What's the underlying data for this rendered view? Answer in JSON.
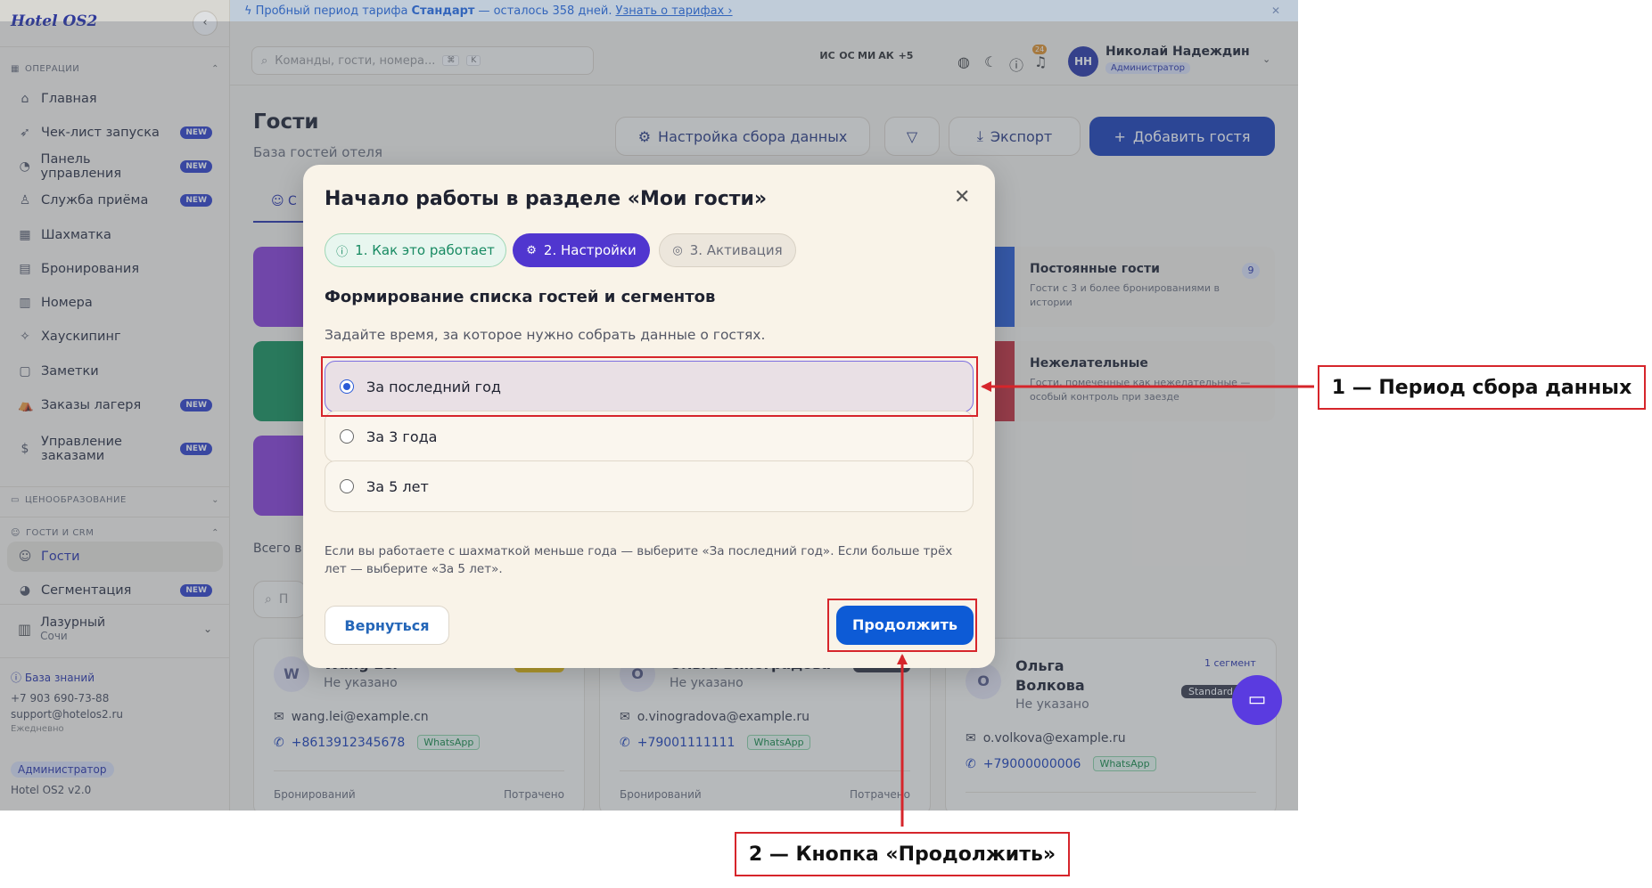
{
  "sidebar": {
    "logo": "Hotel OS2",
    "section_operations": "ОПЕРАЦИИ",
    "items": [
      {
        "label": "Главная",
        "icon": "home-icon",
        "glyph": "⌂",
        "new": false
      },
      {
        "label": "Чек-лист запуска",
        "icon": "rocket-icon",
        "glyph": "➶",
        "new": true
      },
      {
        "label": "Панель управления",
        "icon": "gauge-icon",
        "glyph": "◔",
        "new": true
      },
      {
        "label": "Служба приёма",
        "icon": "bell-icon",
        "glyph": "♙",
        "new": true
      },
      {
        "label": "Шахматка",
        "icon": "grid-icon",
        "glyph": "▦",
        "new": false
      },
      {
        "label": "Бронирования",
        "icon": "clipboard-icon",
        "glyph": "▤",
        "new": false
      },
      {
        "label": "Номера",
        "icon": "building-icon",
        "glyph": "▥",
        "new": false
      },
      {
        "label": "Хаускипинг",
        "icon": "sparkle-icon",
        "glyph": "✧",
        "new": false
      },
      {
        "label": "Заметки",
        "icon": "note-icon",
        "glyph": "▢",
        "new": false
      },
      {
        "label": "Заказы лагеря",
        "icon": "tent-icon",
        "glyph": "⛺",
        "new": true
      },
      {
        "label": "Управление заказами",
        "icon": "dollar-icon",
        "glyph": "$",
        "new": true
      }
    ],
    "section_pricing": "ЦЕНООБРАЗОВАНИЕ",
    "section_crm": "ГОСТИ И CRM",
    "crm_items": [
      {
        "label": "Гости",
        "icon": "users-icon",
        "glyph": "☺",
        "new": false,
        "active": true
      },
      {
        "label": "Сегментация",
        "icon": "pie-icon",
        "glyph": "◕",
        "new": true,
        "active": false
      }
    ],
    "new_badge": "NEW",
    "org_name": "Лазурный",
    "org_city": "Сочи",
    "kb_link": "База знаний",
    "phone": "+7 903 690-73-88",
    "email": "support@hotelos2.ru",
    "schedule": "Ежедневно",
    "role": "Администратор",
    "version": "Hotel OS2 v2.0"
  },
  "banner": {
    "text1": "Пробный период тарифа",
    "plan": "Стандарт",
    "text2": "— осталось 358 дней.",
    "link": "Узнать о тарифах ›"
  },
  "topbar": {
    "search_placeholder": "Команды, гости, номера...",
    "kbd1": "⌘",
    "kbd2": "K",
    "avatars": [
      "ИС",
      "ОС",
      "МИ",
      "АК",
      "+5"
    ],
    "notif_count": "24",
    "user_initials": "НН",
    "user_name": "Николай Надеждин",
    "user_role": "Администратор"
  },
  "page": {
    "title": "Гости",
    "subtitle": "База гостей отеля",
    "tab_stub": "С",
    "btn_settings": "Настройка сбора данных",
    "btn_export": "Экспорт",
    "btn_add": "Добавить гостя",
    "segments": [
      {
        "title": "Постоянные гости",
        "desc": "Гости с 3 и более бронированиями в истории",
        "count": "9"
      },
      {
        "title": "Нежелательные",
        "desc": "Гости, помеченные как нежелательные — особый контроль при заезде"
      }
    ],
    "total_label": "Всего в",
    "guest_search_stub": "П"
  },
  "guests": [
    {
      "initial": "W",
      "name": "Wang Lei",
      "status": "Не указано",
      "email": "wang.lei@example.cn",
      "phone": "+8613912345678",
      "messenger": "WhatsApp",
      "stat_left": "Бронирований",
      "stat_right": "Потрачено"
    },
    {
      "initial": "О",
      "name": "Ольга Виноградова",
      "status": "Не указано",
      "email": "o.vinogradova@example.ru",
      "phone": "+79001111111",
      "messenger": "WhatsApp",
      "stat_left": "Бронирований",
      "stat_right": "Потрачено"
    },
    {
      "initial": "О",
      "name": "Ольга\nВолкова",
      "status": "Не указано",
      "email": "o.volkova@example.ru",
      "phone": "+79000000006",
      "messenger": "WhatsApp",
      "segment_tag": "1 сегмент",
      "plan_tag": "Standard"
    }
  ],
  "modal": {
    "title": "Начало работы в разделе «Мои гости»",
    "steps": [
      "1. Как это работает",
      "2. Настройки",
      "3. Активация"
    ],
    "heading": "Формирование списка гостей и сегментов",
    "description": "Задайте время, за которое нужно собрать данные о гостях.",
    "options": [
      {
        "label": "За последний год",
        "selected": true
      },
      {
        "label": "За 3 года",
        "selected": false
      },
      {
        "label": "За 5 лет",
        "selected": false
      }
    ],
    "hint": "Если вы работаете с шахматкой меньше года — выберите «За последний год». Если больше трёх лет — выберите «За 5 лет».",
    "back_label": "Вернуться",
    "continue_label": "Продолжить"
  },
  "annotations": {
    "callout1": "1 — Период сбора данных",
    "callout2": "2 — Кнопка «Продолжить»",
    "color": "#d6252b"
  },
  "colors": {
    "accent": "#2b35a8",
    "primary_button": "#0d5bd6",
    "step_active": "#5036cf",
    "chat_fab": "#5a3be0"
  }
}
